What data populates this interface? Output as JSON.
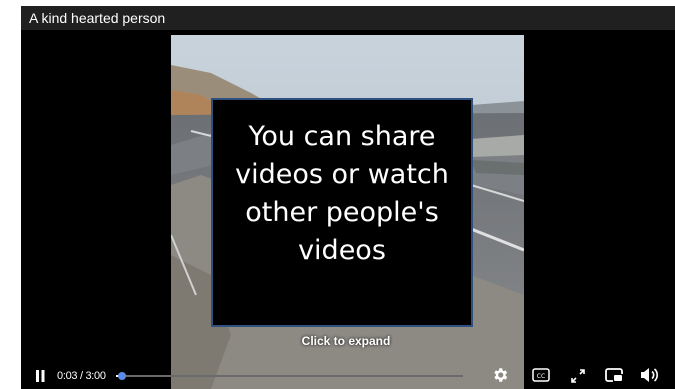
{
  "window": {
    "title": "A kind hearted person"
  },
  "overlay": {
    "message": "You can share\nvideos or watch\nother people's\nvideos"
  },
  "video": {
    "expand_hint": "Click to expand"
  },
  "controls": {
    "time": "0:03 / 3:00",
    "progress_fraction": 0.017,
    "play_state_icon": "pause-icon",
    "icons": [
      "pause-icon",
      "gear-icon",
      "captions-icon",
      "expand-icon",
      "mini-player-icon",
      "volume-icon"
    ]
  },
  "colors": {
    "title_bar": "#202020",
    "player_background": "#000000",
    "overlay_border": "#2f4f7f",
    "progress_knob": "#5b8de8"
  }
}
